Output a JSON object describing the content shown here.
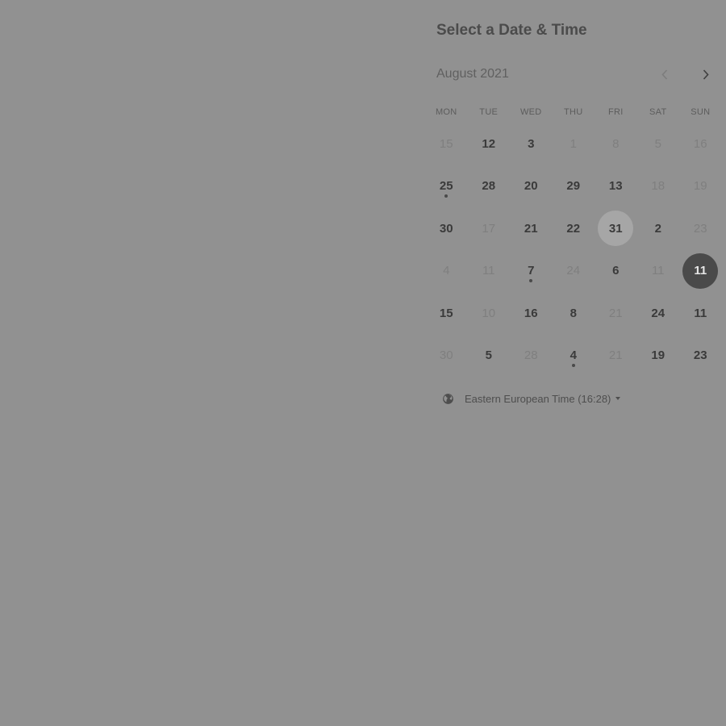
{
  "header": {
    "title": "Select a Date & Time"
  },
  "calendar": {
    "month_label": "August 2021",
    "prev_icon": "chevron-left-icon",
    "next_icon": "chevron-right-icon",
    "weekdays": [
      "MON",
      "TUE",
      "WED",
      "THU",
      "FRI",
      "SAT",
      "SUN"
    ],
    "weeks": [
      [
        {
          "label": "15",
          "available": false
        },
        {
          "label": "12",
          "available": true
        },
        {
          "label": "3",
          "available": true
        },
        {
          "label": "1",
          "available": false
        },
        {
          "label": "8",
          "available": false
        },
        {
          "label": "5",
          "available": false
        },
        {
          "label": "16",
          "available": false
        }
      ],
      [
        {
          "label": "25",
          "available": true,
          "dot": true
        },
        {
          "label": "28",
          "available": true
        },
        {
          "label": "20",
          "available": true
        },
        {
          "label": "29",
          "available": true
        },
        {
          "label": "13",
          "available": true
        },
        {
          "label": "18",
          "available": false
        },
        {
          "label": "19",
          "available": false
        }
      ],
      [
        {
          "label": "30",
          "available": true
        },
        {
          "label": "17",
          "available": false
        },
        {
          "label": "21",
          "available": true
        },
        {
          "label": "22",
          "available": true
        },
        {
          "label": "31",
          "available": true,
          "today": true
        },
        {
          "label": "2",
          "available": true
        },
        {
          "label": "23",
          "available": false
        }
      ],
      [
        {
          "label": "4",
          "available": false
        },
        {
          "label": "11",
          "available": false
        },
        {
          "label": "7",
          "available": true,
          "dot": true
        },
        {
          "label": "24",
          "available": false
        },
        {
          "label": "6",
          "available": true
        },
        {
          "label": "11",
          "available": false
        },
        {
          "label": "11",
          "available": true,
          "selected": true
        }
      ],
      [
        {
          "label": "15",
          "available": true
        },
        {
          "label": "10",
          "available": false
        },
        {
          "label": "16",
          "available": true
        },
        {
          "label": "8",
          "available": true
        },
        {
          "label": "21",
          "available": false
        },
        {
          "label": "24",
          "available": true
        },
        {
          "label": "11",
          "available": true
        }
      ],
      [
        {
          "label": "30",
          "available": false
        },
        {
          "label": "5",
          "available": true
        },
        {
          "label": "28",
          "available": false
        },
        {
          "label": "4",
          "available": true,
          "dot": true
        },
        {
          "label": "21",
          "available": false
        },
        {
          "label": "19",
          "available": true
        },
        {
          "label": "23",
          "available": true
        }
      ]
    ]
  },
  "timezone": {
    "icon": "globe-icon",
    "label": "Eastern European Time (16:28)"
  },
  "colors": {
    "overlay": "#919191",
    "selected": "#4a4a4a",
    "today": "#a6a6a6"
  }
}
